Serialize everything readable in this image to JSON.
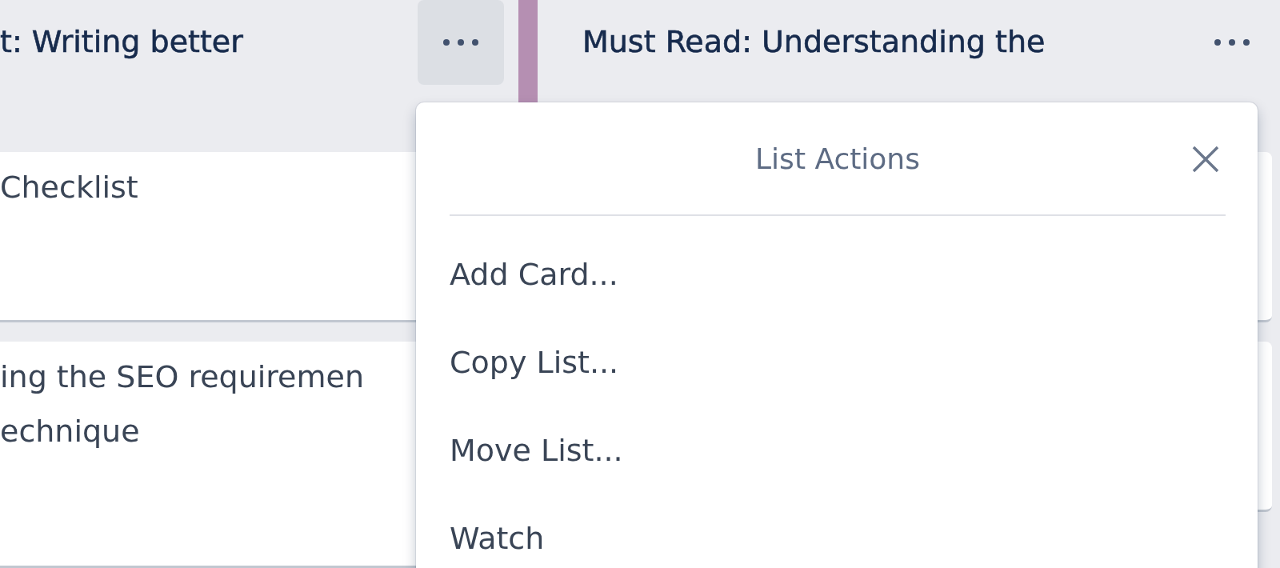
{
  "lists": [
    {
      "title_lines": [
        "t: Writing better"
      ],
      "menu_open": true,
      "cards": [
        {
          "lines": [
            "Checklist"
          ]
        },
        {
          "lines": [
            "ing the SEO requiremen",
            "echnique"
          ]
        }
      ]
    },
    {
      "title_lines": [
        "Must Read: Understanding the"
      ],
      "menu_open": false
    }
  ],
  "popup": {
    "title": "List Actions",
    "items": [
      "Add Card...",
      "Copy List...",
      "Move List...",
      "Watch"
    ]
  }
}
